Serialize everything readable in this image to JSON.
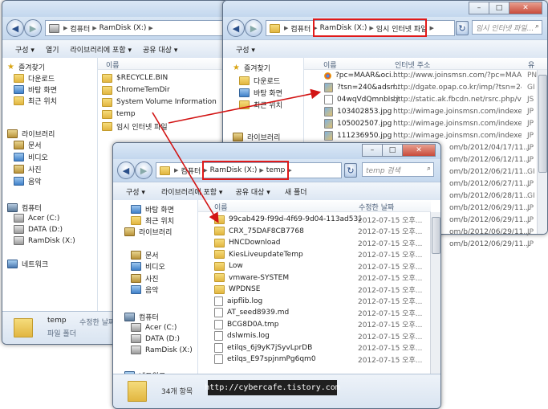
{
  "back_window": {
    "address": [
      "컴퓨터",
      "RamDisk (X:)"
    ],
    "toolbar": [
      "구성 ▾",
      "열기",
      "라이브러리에 포함 ▾",
      "공유 대상 ▾"
    ],
    "column_header": "이름",
    "nav": [
      {
        "label": "즐겨찾기",
        "icon": "star-icon"
      },
      {
        "label": "다운로드",
        "icon": "download-folder-icon"
      },
      {
        "label": "바탕 화면",
        "icon": "desktop-icon"
      },
      {
        "label": "최근 위치",
        "icon": "recent-places-icon"
      },
      {
        "label": "라이브러리",
        "icon": "library-icon"
      },
      {
        "label": "문서",
        "icon": "documents-icon"
      },
      {
        "label": "비디오",
        "icon": "videos-icon"
      },
      {
        "label": "사진",
        "icon": "pictures-icon"
      },
      {
        "label": "음악",
        "icon": "music-icon"
      },
      {
        "label": "컴퓨터",
        "icon": "computer-icon"
      },
      {
        "label": "Acer (C:)",
        "icon": "drive-icon"
      },
      {
        "label": "DATA (D:)",
        "icon": "drive-icon"
      },
      {
        "label": "RamDisk (X:)",
        "icon": "drive-icon"
      },
      {
        "label": "네트워크",
        "icon": "network-icon"
      }
    ],
    "files": [
      "$RECYCLE.BIN",
      "ChromeTemDir",
      "System Volume Information",
      "temp",
      "임시 인터넷 파일"
    ],
    "status": {
      "name": "temp",
      "modified_label": "수정한 날짜",
      "type": "파일 폴더"
    }
  },
  "right_window": {
    "address": [
      "컴퓨터",
      "RamDisk (X:)",
      "임시 인터넷 파일"
    ],
    "search_placeholder": "임시 인터넷 파일...",
    "toolbar": [
      "구성 ▾"
    ],
    "columns": [
      "이름",
      "인터넷 주소",
      "유"
    ],
    "nav": [
      "즐겨찾기",
      "다운로드",
      "바탕 화면",
      "최근 위치",
      "라이브러리"
    ],
    "files": [
      {
        "name": "?pc=MAAR&oci...",
        "url": "http://www.joinsmsn.com/?pc=MAAR&o...",
        "type": "PN"
      },
      {
        "name": "?tsn=240&adsn...",
        "url": "http://dgate.opap.co.kr/imp/?tsn=240&...",
        "type": "GI"
      },
      {
        "name": "04wqVdQmnbIs.js",
        "url": "http://static.ak.fbcdn.net/rsrc.php/v2/s...",
        "type": "JS"
      },
      {
        "name": "103402853.jpg",
        "url": "http://wimage.joinsmsn.com/indexedit/...",
        "type": "JP"
      },
      {
        "name": "105002507.jpg",
        "url": "http://wimage.joinsmsn.com/indexedit/...",
        "type": "JP"
      },
      {
        "name": "111236950.jpg",
        "url": "http://wimage.joinsmsn.com/indexedit/...",
        "type": "JP"
      }
    ],
    "hidden_urls": [
      "om/b/2012/04/17/11...",
      "om/b/2012/06/12/11...",
      "om/b/2012/06/21/11...",
      "om/b/2012/06/27/11...",
      "om/b/2012/06/28/11...",
      "om/b/2012/06/29/11...",
      "om/b/2012/06/29/11...",
      "om/b/2012/06/29/11...",
      "om/b/2012/06/29/11..."
    ],
    "hidden_types": [
      "JP",
      "JP",
      "GI",
      "JP",
      "GI",
      "JP",
      "JP",
      "JP",
      "JP"
    ]
  },
  "front_window": {
    "address": [
      "컴퓨터",
      "RamDisk (X:)",
      "temp"
    ],
    "search_placeholder": "temp 검색",
    "toolbar": [
      "구성 ▾",
      "라이브러리에 포함 ▾",
      "공유 대상 ▾",
      "새 폴더"
    ],
    "columns": [
      "이름",
      "수정한 날짜"
    ],
    "nav": [
      {
        "label": "바탕 화면",
        "icon": "desktop-icon"
      },
      {
        "label": "최근 위치",
        "icon": "recent-places-icon"
      },
      {
        "label": "라이브러리",
        "icon": "library-icon"
      },
      {
        "label": "문서",
        "icon": "documents-icon"
      },
      {
        "label": "비디오",
        "icon": "videos-icon"
      },
      {
        "label": "사진",
        "icon": "pictures-icon"
      },
      {
        "label": "음악",
        "icon": "music-icon"
      },
      {
        "label": "컴퓨터",
        "icon": "computer-icon"
      },
      {
        "label": "Acer (C:)",
        "icon": "drive-icon"
      },
      {
        "label": "DATA (D:)",
        "icon": "drive-icon"
      },
      {
        "label": "RamDisk (X:)",
        "icon": "drive-icon"
      },
      {
        "label": "네트워크",
        "icon": "network-icon"
      }
    ],
    "files": [
      {
        "name": "99cab429-f99d-4f69-9d04-113ad532b...",
        "date": "2012-07-15 오후...",
        "kind": "folder"
      },
      {
        "name": "CRX_75DAF8CB7768",
        "date": "2012-07-15 오후...",
        "kind": "folder"
      },
      {
        "name": "HNCDownload",
        "date": "2012-07-15 오후...",
        "kind": "folder"
      },
      {
        "name": "KiesLiveupdateTemp",
        "date": "2012-07-15 오후...",
        "kind": "folder"
      },
      {
        "name": "Low",
        "date": "2012-07-15 오후...",
        "kind": "folder"
      },
      {
        "name": "vmware-SYSTEM",
        "date": "2012-07-15 오후...",
        "kind": "folder"
      },
      {
        "name": "WPDNSE",
        "date": "2012-07-15 오후...",
        "kind": "folder"
      },
      {
        "name": "aipflib.log",
        "date": "2012-07-15 오후...",
        "kind": "file"
      },
      {
        "name": "AT_seed8939.md",
        "date": "2012-07-15 오후...",
        "kind": "file"
      },
      {
        "name": "BCG8D0A.tmp",
        "date": "2012-07-15 오후...",
        "kind": "file"
      },
      {
        "name": "dslwmis.log",
        "date": "2012-07-15 오후...",
        "kind": "file"
      },
      {
        "name": "etilqs_6j9yK7jSyvLprDB",
        "date": "2012-07-15 오후...",
        "kind": "file"
      },
      {
        "name": "etilqs_E97spjnmPg6qm0",
        "date": "2012-07-15 오후...",
        "kind": "file"
      }
    ],
    "status": "34개 항목"
  },
  "watermark": "http://cybercafe.tistory.com",
  "colors": {
    "highlight_box": "#e01a1a",
    "arrow": "#d21414"
  }
}
